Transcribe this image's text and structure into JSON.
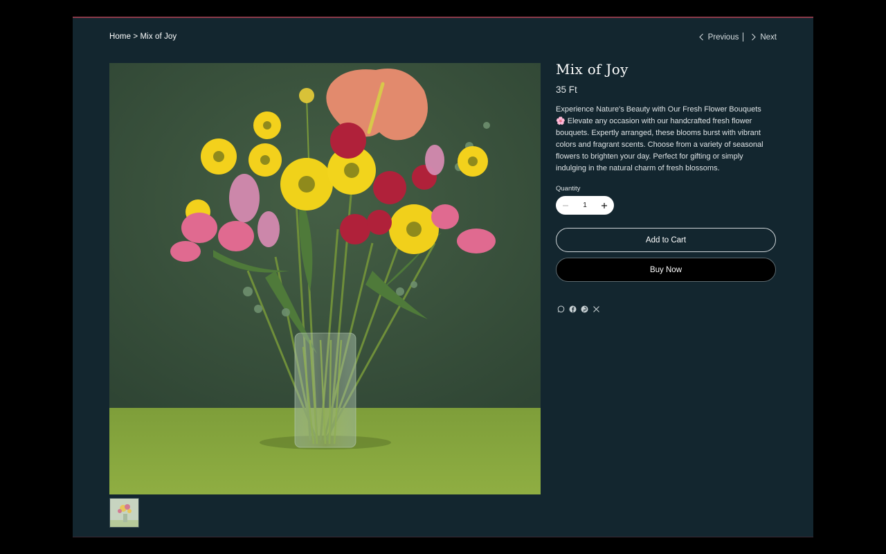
{
  "breadcrumb": {
    "home": "Home",
    "separator": ">",
    "current": "Mix of Joy"
  },
  "pager": {
    "previous": "Previous",
    "next": "Next"
  },
  "product": {
    "title": "Mix of Joy",
    "price": "35 Ft",
    "description_line1": "Experience Nature's Beauty with Our Fresh Flower Bouquets",
    "description_emoji": "🌸",
    "description_rest": " Elevate any occasion with our handcrafted fresh flower bouquets. Expertly arranged, these blooms burst with vibrant colors and fragrant scents. Choose from a variety of seasonal flowers to brighten your day. Perfect for gifting or simply indulging in the natural charm of fresh blossoms.",
    "quantity_label": "Quantity",
    "quantity_value": "1"
  },
  "actions": {
    "add_to_cart": "Add to Cart",
    "buy_now": "Buy Now"
  },
  "share_icons": [
    "whatsapp-icon",
    "facebook-icon",
    "pinterest-icon",
    "x-icon"
  ],
  "colors": {
    "page_bg": "#13262f",
    "backdrop_green": "#3e5a3f",
    "table_green": "#85a83c",
    "top_border": "#8c3a4a"
  }
}
